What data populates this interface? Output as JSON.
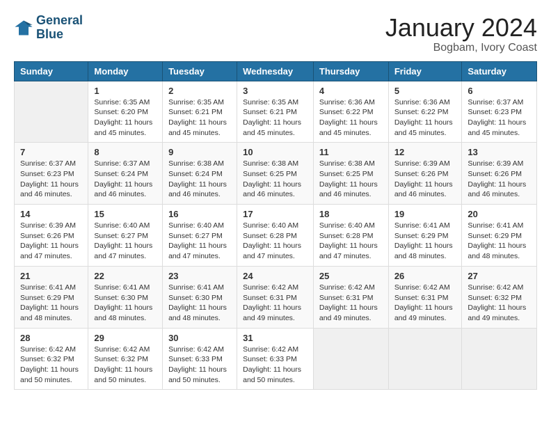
{
  "header": {
    "logo_line1": "General",
    "logo_line2": "Blue",
    "month_title": "January 2024",
    "location": "Bogbam, Ivory Coast"
  },
  "weekdays": [
    "Sunday",
    "Monday",
    "Tuesday",
    "Wednesday",
    "Thursday",
    "Friday",
    "Saturday"
  ],
  "weeks": [
    [
      {
        "day": "",
        "empty": true
      },
      {
        "day": "1",
        "sunrise": "6:35 AM",
        "sunset": "6:20 PM",
        "daylight": "11 hours and 45 minutes."
      },
      {
        "day": "2",
        "sunrise": "6:35 AM",
        "sunset": "6:21 PM",
        "daylight": "11 hours and 45 minutes."
      },
      {
        "day": "3",
        "sunrise": "6:35 AM",
        "sunset": "6:21 PM",
        "daylight": "11 hours and 45 minutes."
      },
      {
        "day": "4",
        "sunrise": "6:36 AM",
        "sunset": "6:22 PM",
        "daylight": "11 hours and 45 minutes."
      },
      {
        "day": "5",
        "sunrise": "6:36 AM",
        "sunset": "6:22 PM",
        "daylight": "11 hours and 45 minutes."
      },
      {
        "day": "6",
        "sunrise": "6:37 AM",
        "sunset": "6:23 PM",
        "daylight": "11 hours and 45 minutes."
      }
    ],
    [
      {
        "day": "7",
        "sunrise": "6:37 AM",
        "sunset": "6:23 PM",
        "daylight": "11 hours and 46 minutes."
      },
      {
        "day": "8",
        "sunrise": "6:37 AM",
        "sunset": "6:24 PM",
        "daylight": "11 hours and 46 minutes."
      },
      {
        "day": "9",
        "sunrise": "6:38 AM",
        "sunset": "6:24 PM",
        "daylight": "11 hours and 46 minutes."
      },
      {
        "day": "10",
        "sunrise": "6:38 AM",
        "sunset": "6:25 PM",
        "daylight": "11 hours and 46 minutes."
      },
      {
        "day": "11",
        "sunrise": "6:38 AM",
        "sunset": "6:25 PM",
        "daylight": "11 hours and 46 minutes."
      },
      {
        "day": "12",
        "sunrise": "6:39 AM",
        "sunset": "6:26 PM",
        "daylight": "11 hours and 46 minutes."
      },
      {
        "day": "13",
        "sunrise": "6:39 AM",
        "sunset": "6:26 PM",
        "daylight": "11 hours and 46 minutes."
      }
    ],
    [
      {
        "day": "14",
        "sunrise": "6:39 AM",
        "sunset": "6:26 PM",
        "daylight": "11 hours and 47 minutes."
      },
      {
        "day": "15",
        "sunrise": "6:40 AM",
        "sunset": "6:27 PM",
        "daylight": "11 hours and 47 minutes."
      },
      {
        "day": "16",
        "sunrise": "6:40 AM",
        "sunset": "6:27 PM",
        "daylight": "11 hours and 47 minutes."
      },
      {
        "day": "17",
        "sunrise": "6:40 AM",
        "sunset": "6:28 PM",
        "daylight": "11 hours and 47 minutes."
      },
      {
        "day": "18",
        "sunrise": "6:40 AM",
        "sunset": "6:28 PM",
        "daylight": "11 hours and 47 minutes."
      },
      {
        "day": "19",
        "sunrise": "6:41 AM",
        "sunset": "6:29 PM",
        "daylight": "11 hours and 48 minutes."
      },
      {
        "day": "20",
        "sunrise": "6:41 AM",
        "sunset": "6:29 PM",
        "daylight": "11 hours and 48 minutes."
      }
    ],
    [
      {
        "day": "21",
        "sunrise": "6:41 AM",
        "sunset": "6:29 PM",
        "daylight": "11 hours and 48 minutes."
      },
      {
        "day": "22",
        "sunrise": "6:41 AM",
        "sunset": "6:30 PM",
        "daylight": "11 hours and 48 minutes."
      },
      {
        "day": "23",
        "sunrise": "6:41 AM",
        "sunset": "6:30 PM",
        "daylight": "11 hours and 48 minutes."
      },
      {
        "day": "24",
        "sunrise": "6:42 AM",
        "sunset": "6:31 PM",
        "daylight": "11 hours and 49 minutes."
      },
      {
        "day": "25",
        "sunrise": "6:42 AM",
        "sunset": "6:31 PM",
        "daylight": "11 hours and 49 minutes."
      },
      {
        "day": "26",
        "sunrise": "6:42 AM",
        "sunset": "6:31 PM",
        "daylight": "11 hours and 49 minutes."
      },
      {
        "day": "27",
        "sunrise": "6:42 AM",
        "sunset": "6:32 PM",
        "daylight": "11 hours and 49 minutes."
      }
    ],
    [
      {
        "day": "28",
        "sunrise": "6:42 AM",
        "sunset": "6:32 PM",
        "daylight": "11 hours and 50 minutes."
      },
      {
        "day": "29",
        "sunrise": "6:42 AM",
        "sunset": "6:32 PM",
        "daylight": "11 hours and 50 minutes."
      },
      {
        "day": "30",
        "sunrise": "6:42 AM",
        "sunset": "6:33 PM",
        "daylight": "11 hours and 50 minutes."
      },
      {
        "day": "31",
        "sunrise": "6:42 AM",
        "sunset": "6:33 PM",
        "daylight": "11 hours and 50 minutes."
      },
      {
        "day": "",
        "empty": true
      },
      {
        "day": "",
        "empty": true
      },
      {
        "day": "",
        "empty": true
      }
    ]
  ],
  "labels": {
    "sunrise": "Sunrise:",
    "sunset": "Sunset:",
    "daylight": "Daylight:"
  }
}
